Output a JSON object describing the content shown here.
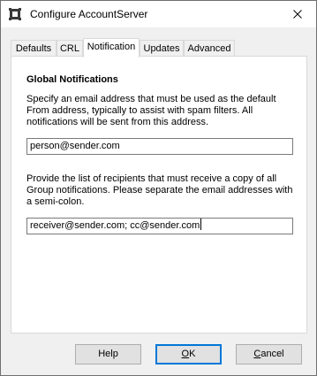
{
  "window": {
    "title": "Configure AccountServer"
  },
  "tabs": [
    {
      "label": "Defaults"
    },
    {
      "label": "CRL"
    },
    {
      "label": "Notification",
      "active": true
    },
    {
      "label": "Updates"
    },
    {
      "label": "Advanced"
    }
  ],
  "notification": {
    "section_title": "Global Notifications",
    "from_description_lines": [
      "Specify an email address that must be used as the default",
      "From address, typically to assist with spam filters.  All",
      "notifications will be sent from this address."
    ],
    "from_address": "person@sender.com",
    "recipients_description_lines": [
      "Provide the list of recipients that must receive a copy of all",
      "Group notifications. Please separate the email addresses with",
      "a semi-colon."
    ],
    "recipients": "receiver@sender.com; cc@sender.com"
  },
  "buttons": {
    "help": "Help",
    "ok_mnemonic": "O",
    "ok_rest": "K",
    "cancel_mnemonic": "C",
    "cancel_rest": "ancel"
  },
  "icons": {
    "app": "app-gear-icon",
    "close": "close-icon"
  },
  "colors": {
    "accent": "#0078d7"
  }
}
